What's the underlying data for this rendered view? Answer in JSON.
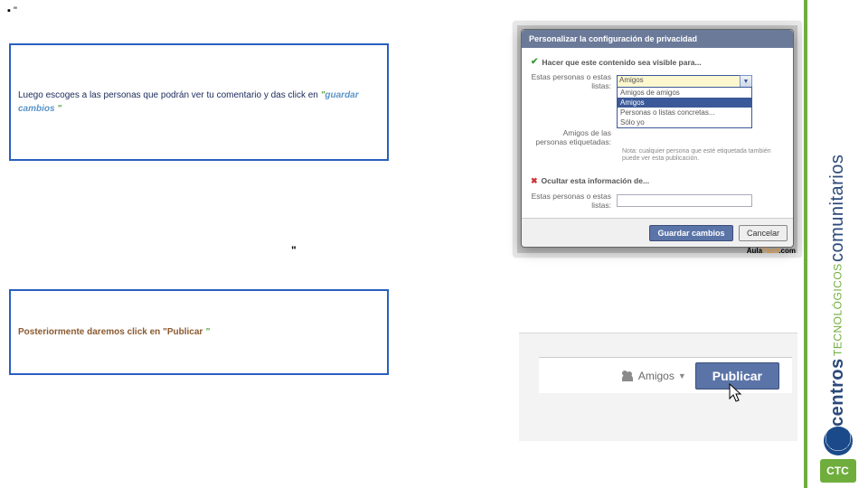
{
  "bullet": "▪  \"",
  "box1": {
    "text_before": "Luego escoges a las personas que podrán ver tu comentario y das click en ",
    "quote_open": "\"",
    "emphasis": "guardar cambios",
    "quote_close": " \""
  },
  "double_quote_marker": "\"",
  "box2": {
    "text_before": "Posteriormente daremos click en ",
    "quote_open": "\"",
    "word": "Publicar",
    "space_quote": " \""
  },
  "dialog": {
    "title": "Personalizar la configuración de privacidad",
    "visible_section": "Hacer que este contenido sea visible para...",
    "row1_label": "Estas personas o estas listas:",
    "selected": "Amigos",
    "options": {
      "o1": "Amigos de amigos",
      "o2": "Amigos",
      "o3": "Personas o listas concretas...",
      "o4": "Sólo yo"
    },
    "row2_label": "Amigos de las personas etiquetadas:",
    "row2_value": "",
    "note": "Nota: cualquier persona que esté etiquetada también puede ver esta publicación.",
    "hide_section": "Ocultar esta información de...",
    "row3_label": "Estas personas o estas listas:",
    "save": "Guardar cambios",
    "cancel": "Cancelar",
    "watermark": "Aula",
    "watermark2": "Facil",
    "watermark3": ".com"
  },
  "publish": {
    "amigos": "Amigos",
    "button": "Publicar"
  },
  "sidebar": {
    "word1": "centros",
    "word2": "TECNOLÓGICOS",
    "word3": "comunitarios",
    "ctc": "CTC"
  }
}
